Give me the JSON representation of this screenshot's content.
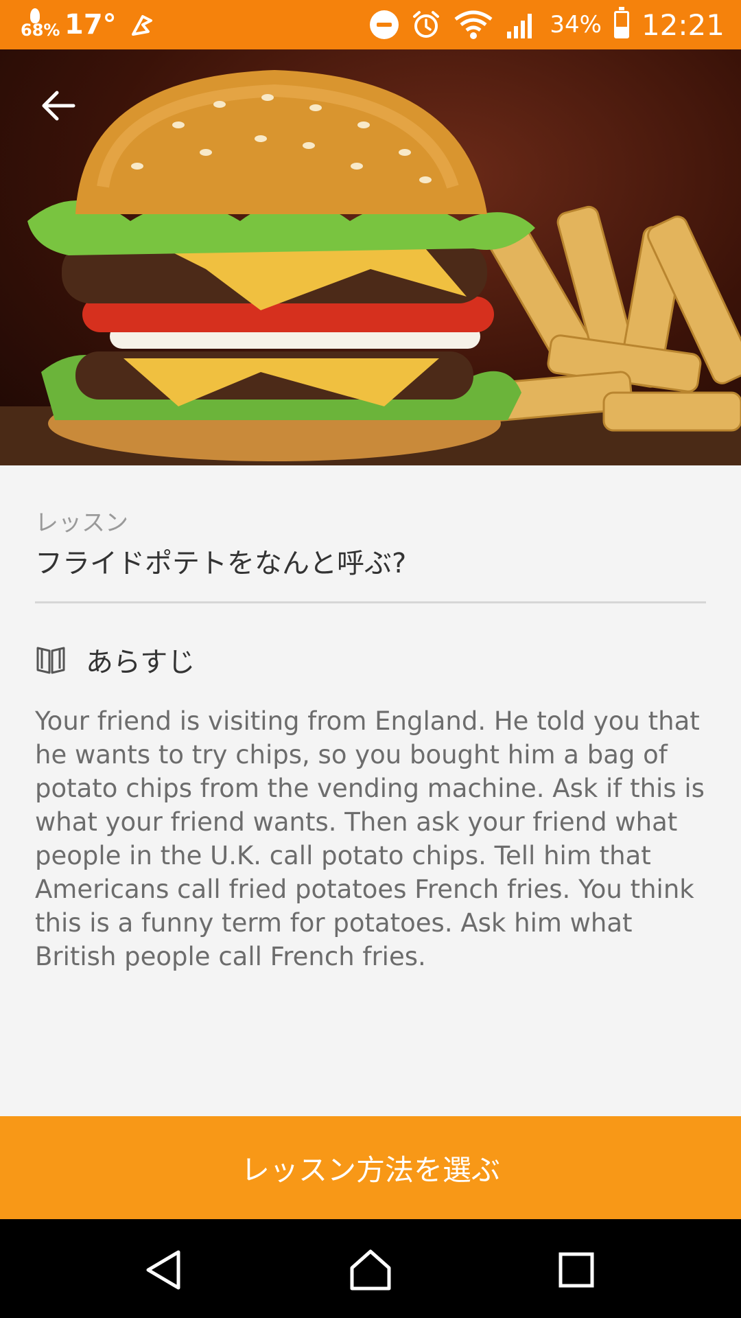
{
  "status_bar": {
    "battery_small": "68%",
    "temperature": "17°",
    "battery_percent": "34%",
    "time": "12:21"
  },
  "hero": {
    "image": "burger-and-fries-photo"
  },
  "lesson": {
    "caption": "レッスン",
    "title": "フライドポテトをなんと呼ぶ?"
  },
  "synopsis": {
    "heading": "あらすじ",
    "text": "Your friend is visiting from England. He told you that he wants to try chips, so you bought him a bag of potato chips from the vending machine. Ask if this is what your friend wants. Then ask your friend what people in the U.K. call potato chips. Tell him that Americans call fried potatoes French fries. You think this is a funny term for potatoes. Ask him what British people call French fries."
  },
  "cta": {
    "label": "レッスン方法を選ぶ"
  },
  "colors": {
    "status_bar": "#f5820c",
    "cta": "#f89817",
    "background": "#f4f4f4"
  }
}
